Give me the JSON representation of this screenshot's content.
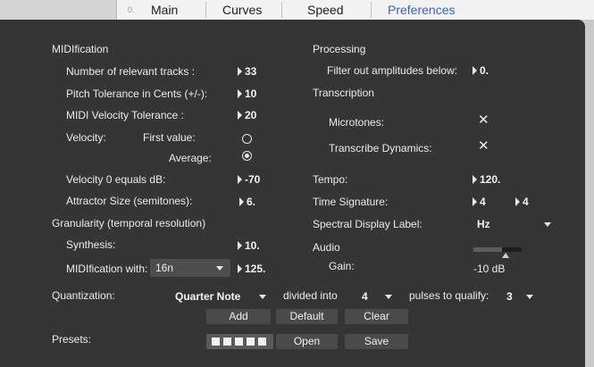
{
  "tabs": {
    "number": "0.",
    "items": [
      "Main",
      "Curves",
      "Speed",
      "Preferences"
    ],
    "active_index": 3
  },
  "midification": {
    "heading": "MIDIfication",
    "tracks_label": "Number of relevant tracks :",
    "tracks_value": "33",
    "pitch_label": "Pitch Tolerance in Cents (+/-):",
    "pitch_value": "10",
    "velocity_tol_label": "MIDI Velocity Tolerance :",
    "velocity_tol_value": "20",
    "velocity_label": "Velocity:",
    "first_value_label": "First value:",
    "average_label": "Average:",
    "velocity_mode": "average",
    "velocity_zero_label": "Velocity 0 equals dB:",
    "velocity_zero_value": "-70",
    "attractor_label": "Attractor Size (semitones):",
    "attractor_value": "6."
  },
  "granularity": {
    "heading": "Granularity (temporal resolution)",
    "synthesis_label": "Synthesis:",
    "synthesis_value": "10.",
    "midification_with_label": "MIDIfication with:",
    "midification_with_selected": "16n",
    "midification_with_value": "125."
  },
  "processing": {
    "heading": "Processing",
    "filter_label": "Filter out amplitudes below:",
    "filter_value": "0."
  },
  "transcription": {
    "heading": "Transcription",
    "microtones_label": "Microtones:",
    "dynamics_label": "Transcribe Dynamics:",
    "check_glyph": "✕"
  },
  "tempo": {
    "label": "Tempo:",
    "value": "120."
  },
  "time_signature": {
    "label": "Time Signature:",
    "numerator": "4",
    "denominator": "4"
  },
  "spectral": {
    "label": "Spectral Display Label:",
    "selected": "Hz"
  },
  "audio": {
    "heading": "Audio",
    "gain_label": "Gain:",
    "gain_value": "-10 dB",
    "gain_level_fraction": 0.6
  },
  "quantization": {
    "label": "Quantization:",
    "note_value": "Quarter Note",
    "divided_label": "divided into",
    "divided_value": "4",
    "pulses_label": "pulses to qualify:",
    "pulses_value": "3"
  },
  "buttons": {
    "add": "Add",
    "default": "Default",
    "clear": "Clear",
    "open": "Open",
    "save": "Save"
  },
  "presets": {
    "label": "Presets:",
    "slot_count": 5
  },
  "colors": {
    "panel_bg": "#353535",
    "button_bg": "#4a4a4a",
    "active_tab": "#2f62d4"
  }
}
